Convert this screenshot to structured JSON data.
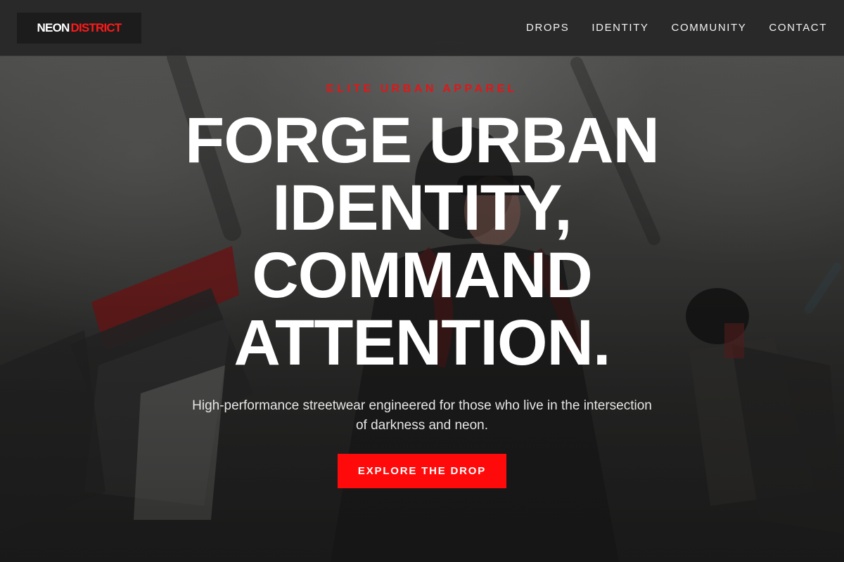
{
  "header": {
    "logo": {
      "part1": "NEON",
      "part2": "DISTRICT"
    },
    "nav": [
      {
        "label": "DROPS"
      },
      {
        "label": "IDENTITY"
      },
      {
        "label": "COMMUNITY"
      },
      {
        "label": "CONTACT"
      }
    ]
  },
  "hero": {
    "eyebrow": "ELITE URBAN APPAREL",
    "headline_lines": [
      "FORGE URBAN",
      "IDENTITY,",
      "COMMAND",
      "ATTENTION."
    ],
    "subtext": "High-performance streetwear engineered for those who live in the intersection of darkness and neon.",
    "cta_label": "EXPLORE THE DROP"
  },
  "colors": {
    "accent": "#ff0a0a",
    "header_bg": "#282828",
    "text": "#ffffff"
  }
}
